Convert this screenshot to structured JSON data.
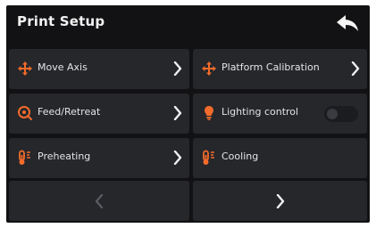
{
  "header": {
    "title": "Print Setup",
    "back_icon": "back-arrow-icon"
  },
  "menu": {
    "move_axis": {
      "label": "Move Axis",
      "icon": "move-axis-icon"
    },
    "platform_calibration": {
      "label": "Platform Calibration",
      "icon": "move-axis-icon"
    },
    "feed_retreat": {
      "label": "Feed/Retreat",
      "icon": "filament-icon"
    },
    "lighting_control": {
      "label": "Lighting control",
      "icon": "light-bulb-icon",
      "enabled": false
    },
    "preheating": {
      "label": "Preheating",
      "icon": "thermometer-icon"
    },
    "cooling": {
      "label": "Cooling",
      "icon": "thermometer-icon"
    }
  },
  "pagination": {
    "prev_icon": "chevron-left-icon",
    "next_icon": "chevron-right-icon"
  },
  "colors": {
    "background": "#121214",
    "tile": "#26272b",
    "accent": "#f36b2b",
    "text": "#e4e4e4"
  }
}
